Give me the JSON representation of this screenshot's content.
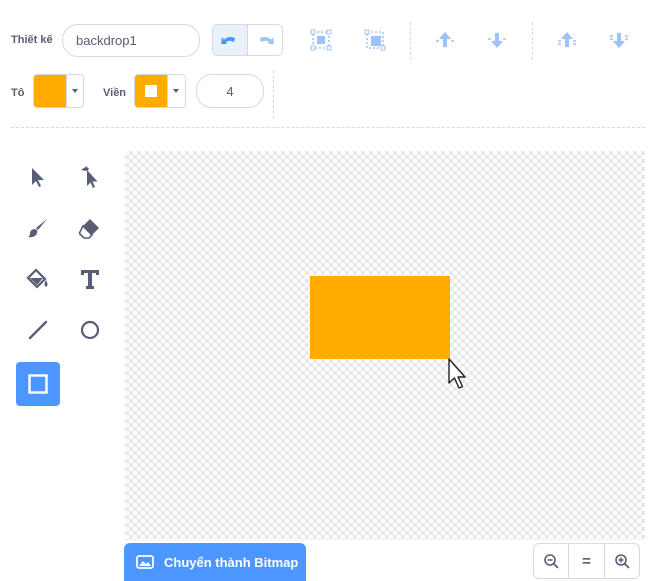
{
  "toolbar": {
    "costume_label": "Thiết kế",
    "costume_name": "backdrop1",
    "fill_label": "Tô",
    "outline_label": "Viền",
    "outline_width": "4"
  },
  "icons": {
    "undo": "undo-icon",
    "redo": "redo-icon",
    "group": "group-icon",
    "ungroup": "ungroup-icon",
    "forward": "forward-icon",
    "backward": "backward-icon",
    "front": "front-icon",
    "back": "back-icon"
  },
  "tools": [
    "select",
    "reshape",
    "brush",
    "eraser",
    "fill",
    "text",
    "line",
    "circle",
    "rectangle"
  ],
  "selected_tool": "rectangle",
  "colors": {
    "fill": "#ffab00",
    "outline": "#ffab00",
    "accent": "#4c97ff",
    "text": "#575e75",
    "shape": "#ffab00"
  },
  "footer": {
    "convert_label": "Chuyển thành Bitmap"
  },
  "zoom": {
    "out": "zoom-out-icon",
    "reset": "=",
    "in": "zoom-in-icon"
  }
}
